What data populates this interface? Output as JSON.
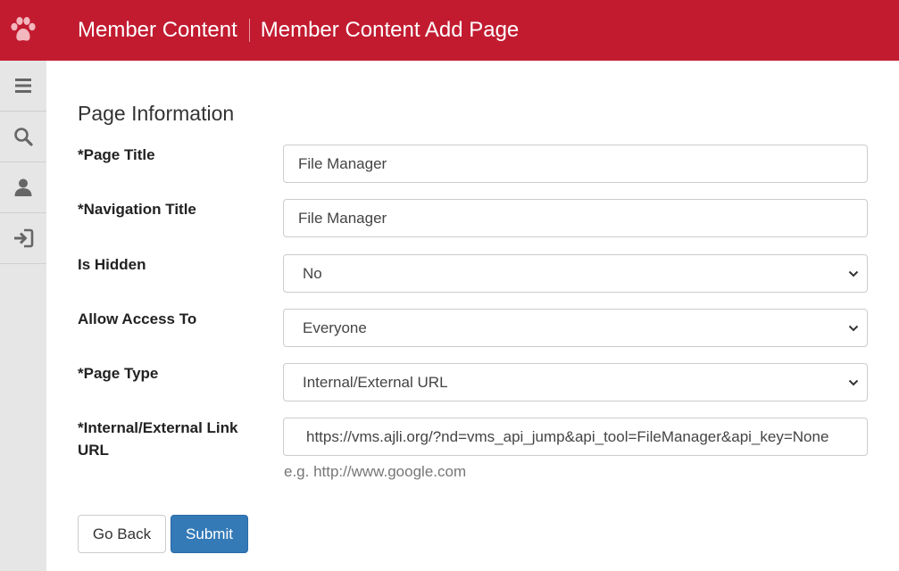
{
  "header": {
    "app_name": "Member Content",
    "page_name": "Member Content Add Page"
  },
  "sidebar": {
    "items": [
      {
        "icon": "menu-icon"
      },
      {
        "icon": "search-icon"
      },
      {
        "icon": "user-icon"
      },
      {
        "icon": "logout-icon"
      }
    ]
  },
  "form": {
    "section_title": "Page Information",
    "page_title_label": "*Page Title",
    "page_title_value": "File Manager",
    "nav_title_label": "*Navigation Title",
    "nav_title_value": "File Manager",
    "is_hidden_label": "Is Hidden",
    "is_hidden_value": "No",
    "allow_access_label": "Allow Access To",
    "allow_access_value": "Everyone",
    "page_type_label": "*Page Type",
    "page_type_value": "Internal/External URL",
    "link_url_label": "*Internal/External Link URL",
    "link_url_value": "https://vms.ajli.org/?nd=vms_api_jump&api_tool=FileManager&api_key=None",
    "link_url_help": "e.g. http://www.google.com"
  },
  "buttons": {
    "back_label": "Go Back",
    "submit_label": "Submit"
  },
  "colors": {
    "brand": "#c21b30",
    "primary_button": "#337ab7"
  }
}
